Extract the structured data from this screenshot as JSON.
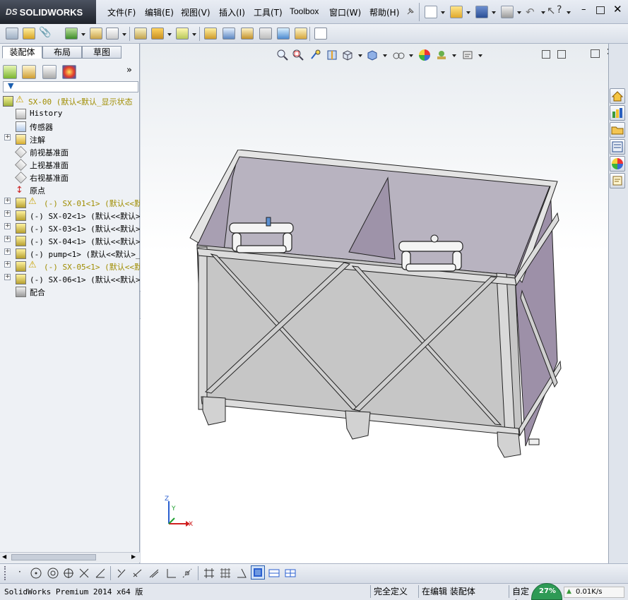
{
  "app": {
    "brand": "SOLIDWORKS",
    "brand_prefix": "DS"
  },
  "menu": [
    "文件(F)",
    "编辑(E)",
    "视图(V)",
    "插入(I)",
    "工具(T)",
    "Toolbox",
    "窗口(W)",
    "帮助(H)"
  ],
  "panel_tabs": [
    "装配体",
    "布局",
    "草图"
  ],
  "tree": {
    "root": "SX-00  (默认<默认_显示状态",
    "items": [
      {
        "label": "History",
        "icon": "history-icon",
        "expander": false,
        "mono": true
      },
      {
        "label": "传感器",
        "icon": "sensor-icon",
        "expander": false
      },
      {
        "label": "注解",
        "icon": "annotation-icon",
        "expander": true
      },
      {
        "label": "前视基准面",
        "icon": "plane-icon",
        "expander": false
      },
      {
        "label": "上视基准面",
        "icon": "plane-icon",
        "expander": false
      },
      {
        "label": "右视基准面",
        "icon": "plane-icon",
        "expander": false
      },
      {
        "label": "原点",
        "icon": "origin-icon",
        "expander": false
      },
      {
        "label": "(-) SX-01<1> (默认<<默认",
        "icon": "part-icon",
        "expander": true,
        "warn": true
      },
      {
        "label": "(-) SX-02<1> (默认<<默认>_",
        "icon": "part-icon",
        "expander": true
      },
      {
        "label": "(-) SX-03<1> (默认<<默认>_",
        "icon": "part-icon",
        "expander": true
      },
      {
        "label": "(-) SX-04<1> (默认<<默认>_",
        "icon": "part-icon",
        "expander": true
      },
      {
        "label": "(-) pump<1> (默认<<默认>_显",
        "icon": "part-icon",
        "expander": true
      },
      {
        "label": "(-) SX-05<1> (默认<<默认",
        "icon": "part-icon",
        "expander": true,
        "warn": true
      },
      {
        "label": "(-) SX-06<1> (默认<<默认>_",
        "icon": "part-icon",
        "expander": true
      },
      {
        "label": "配合",
        "icon": "mates-icon",
        "expander": false
      }
    ]
  },
  "triad": {
    "x": "X",
    "y": "Y",
    "z": "Z"
  },
  "status": {
    "product": "SolidWorks Premium 2014 x64 版",
    "definition": "完全定义",
    "mode": "在编辑 装配体",
    "custom": "自定义",
    "net_speed": "0.01K/s",
    "percent": "27%"
  },
  "colors": {
    "accent": "#1c5fb0",
    "panel_bg": "#eef1f5",
    "warning": "#a08d00"
  }
}
